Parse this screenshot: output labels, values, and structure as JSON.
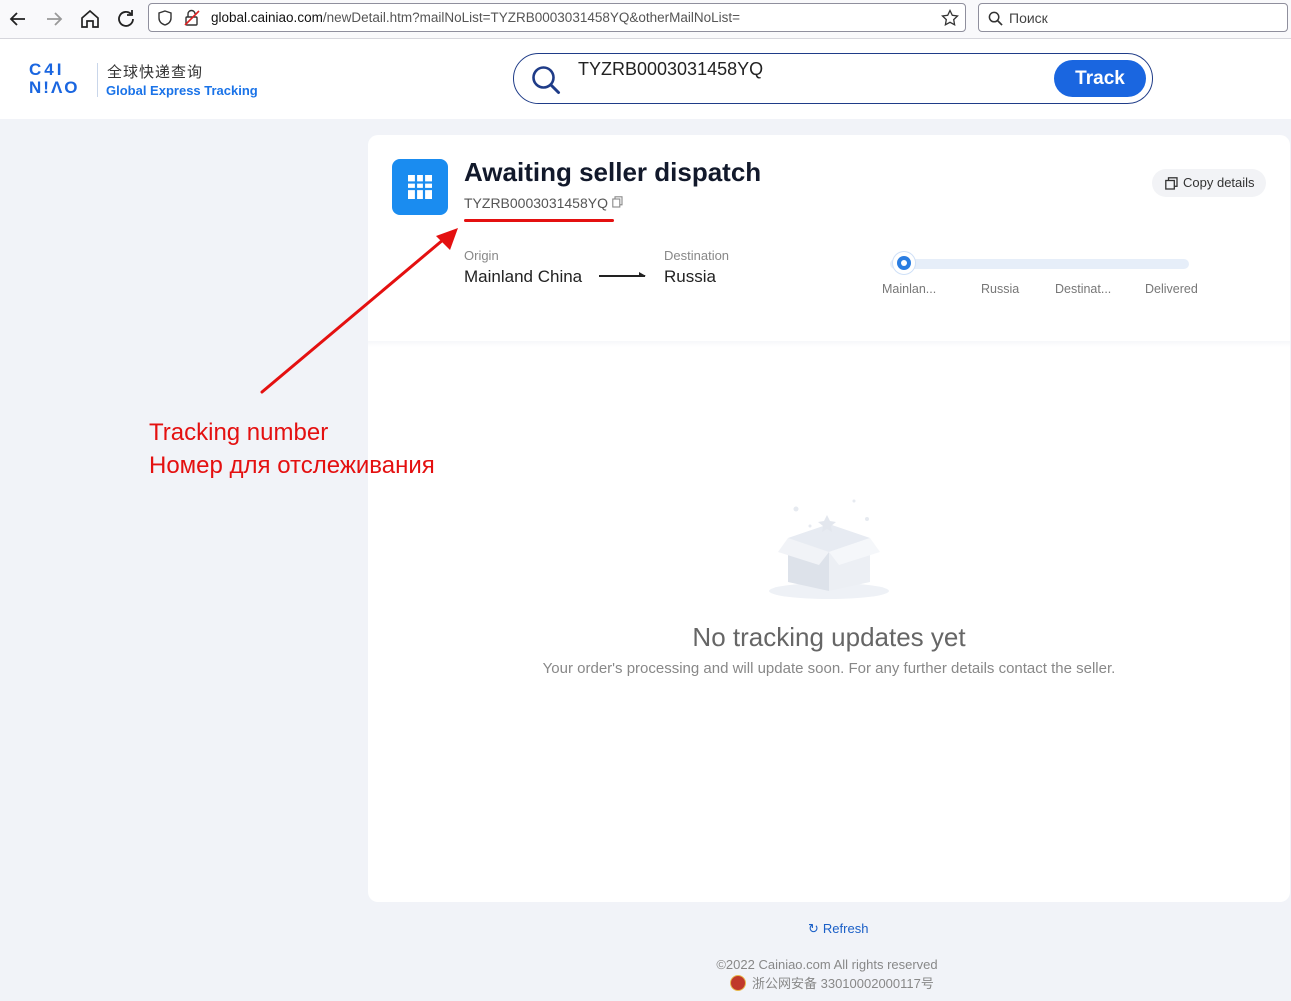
{
  "browser": {
    "url_host": "global.cainiao.com",
    "url_path": "/newDetail.htm?mailNoList=TYZRB0003031458YQ&otherMailNoList=",
    "search_placeholder": "Поиск"
  },
  "header": {
    "logo_text_line1": "C4I",
    "logo_text_line2": "N!ΛO",
    "logo_cn": "全球快递查询",
    "logo_en": "Global Express Tracking",
    "search_value": "TYZRB0003031458YQ",
    "track_button": "Track"
  },
  "card": {
    "status_title": "Awaiting seller dispatch",
    "tracking_number": "TYZRB0003031458YQ",
    "copy_details_label": "Copy details",
    "origin_label": "Origin",
    "origin_value": "Mainland China",
    "destination_label": "Destination",
    "destination_value": "Russia",
    "progress_steps": [
      "Mainlan...",
      "Russia",
      "Destinat...",
      "Delivered"
    ],
    "current_step": 0,
    "empty_title": "No tracking updates yet",
    "empty_desc": "Your order's processing and will update soon. For any further details contact the seller."
  },
  "annotation": {
    "label_en": "Tracking number",
    "label_ru": "Номер для отслеживания",
    "color": "#e41010"
  },
  "footer": {
    "refresh_label": "Refresh",
    "copyright": "©2022  Cainiao.com  All rights reserved",
    "beian": "浙公网安备 33010002000117号"
  },
  "colors": {
    "brand_blue": "#1a66e0",
    "status_icon": "#1a8cf0",
    "page_bg": "#f1f3f8"
  }
}
